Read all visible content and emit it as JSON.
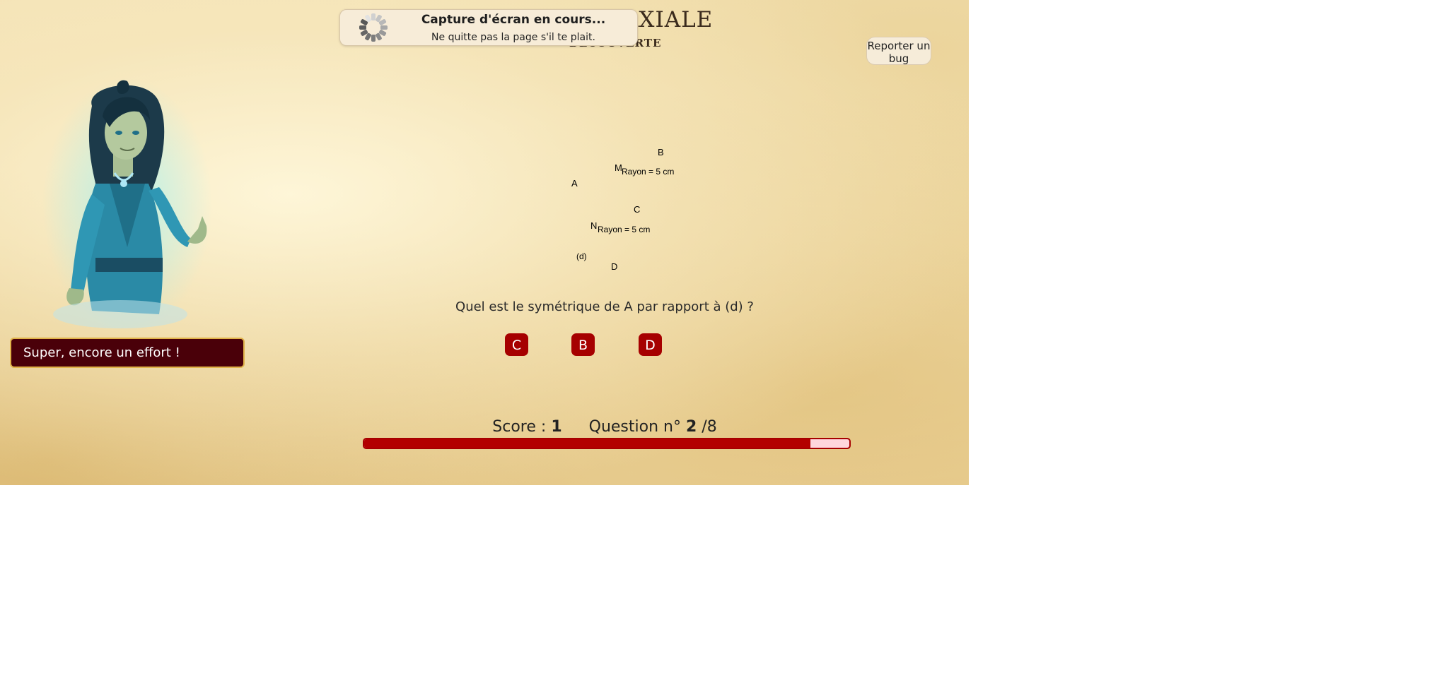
{
  "header": {
    "title": "AXIALE",
    "subtitle": "DÉCOUVERTE"
  },
  "capture_banner": {
    "title": "Capture d'écran en cours...",
    "message": "Ne quitte pas la page s'il te plait."
  },
  "report_bug": {
    "label": "Reporter un bug"
  },
  "feedback": {
    "message": "Super, encore un effort !"
  },
  "figure": {
    "points": [
      {
        "name": "B",
        "label": "B"
      },
      {
        "name": "M",
        "label": "M"
      },
      {
        "name": "A",
        "label": "A"
      },
      {
        "name": "C",
        "label": "C"
      },
      {
        "name": "N",
        "label": "N"
      },
      {
        "name": "d",
        "label": "(d)"
      },
      {
        "name": "D",
        "label": "D"
      }
    ],
    "radius_labels": [
      "Rayon = 5 cm",
      "Rayon = 5 cm"
    ]
  },
  "question": {
    "text": "Quel est le symétrique de A par rapport à (d) ?"
  },
  "answers": [
    "C",
    "B",
    "D"
  ],
  "status": {
    "score_label": "Score :",
    "score_value": "1",
    "question_label": "Question n°",
    "question_number": "2",
    "question_total": "/8",
    "progress": 0.92
  },
  "colors": {
    "answer_bg": "#a60000",
    "feedback_bg": "#4a0009",
    "progress_fill": "#b30000",
    "progress_track": "#ffd6dc"
  }
}
